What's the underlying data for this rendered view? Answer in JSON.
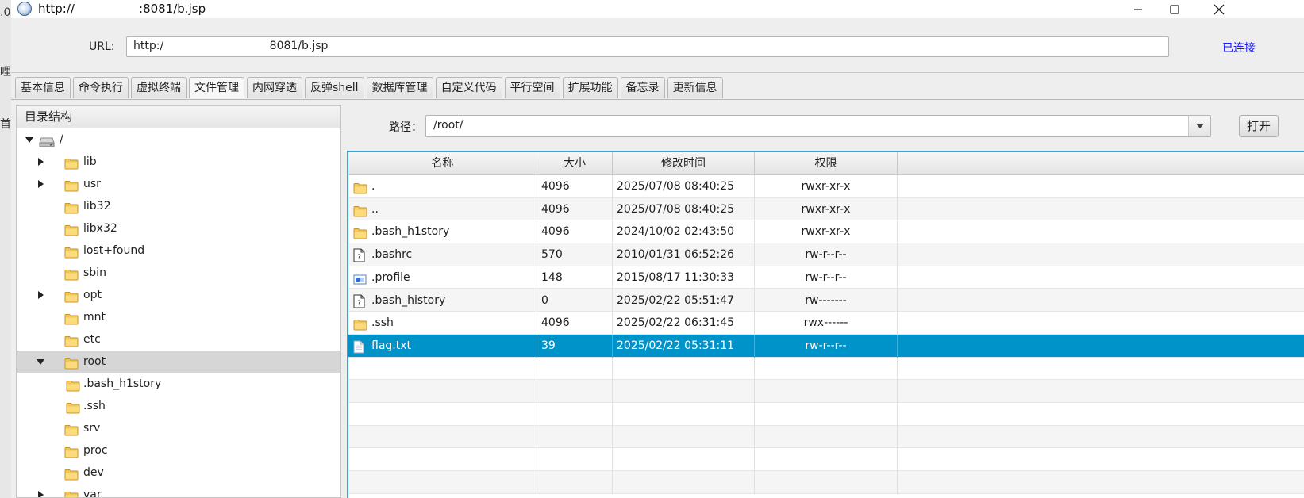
{
  "background": {
    "left_chars": [
      ".0",
      "哩",
      "首"
    ]
  },
  "window": {
    "title": "http://                 :8081/b.jsp",
    "controls": {
      "minimize": "minimize-icon",
      "maximize": "maximize-icon",
      "close": "close-icon"
    }
  },
  "url_bar": {
    "label": "URL:",
    "value": "http:/                              8081/b.jsp",
    "status": "已连接",
    "status_color": "#1a1aff"
  },
  "tabs": [
    {
      "label": "基本信息"
    },
    {
      "label": "命令执行"
    },
    {
      "label": "虚拟终端"
    },
    {
      "label": "文件管理",
      "active": true
    },
    {
      "label": "内网穿透"
    },
    {
      "label": "反弹shell"
    },
    {
      "label": "数据库管理"
    },
    {
      "label": "自定义代码"
    },
    {
      "label": "平行空间"
    },
    {
      "label": "扩展功能"
    },
    {
      "label": "备忘录"
    },
    {
      "label": "更新信息"
    }
  ],
  "tree": {
    "header": "目录结构",
    "items": [
      {
        "label": "/",
        "level": 0,
        "state": "expanded",
        "icon": "drive-icon"
      },
      {
        "label": "lib",
        "level": 1,
        "state": "collapsed",
        "icon": "folder-icon"
      },
      {
        "label": "usr",
        "level": 1,
        "state": "collapsed",
        "icon": "folder-icon"
      },
      {
        "label": "lib32",
        "level": 1,
        "state": "leaf",
        "icon": "folder-icon"
      },
      {
        "label": "libx32",
        "level": 1,
        "state": "leaf",
        "icon": "folder-icon"
      },
      {
        "label": "lost+found",
        "level": 1,
        "state": "leaf",
        "icon": "folder-icon"
      },
      {
        "label": "sbin",
        "level": 1,
        "state": "leaf",
        "icon": "folder-icon"
      },
      {
        "label": "opt",
        "level": 1,
        "state": "collapsed",
        "icon": "folder-icon"
      },
      {
        "label": "mnt",
        "level": 1,
        "state": "leaf",
        "icon": "folder-icon"
      },
      {
        "label": "etc",
        "level": 1,
        "state": "leaf",
        "icon": "folder-icon"
      },
      {
        "label": "root",
        "level": 1,
        "state": "expanded",
        "icon": "folder-icon",
        "selected": true
      },
      {
        "label": ".bash_h1story",
        "level": 2,
        "state": "leaf",
        "icon": "folder-icon"
      },
      {
        "label": ".ssh",
        "level": 2,
        "state": "leaf",
        "icon": "folder-icon"
      },
      {
        "label": "srv",
        "level": 1,
        "state": "leaf",
        "icon": "folder-icon"
      },
      {
        "label": "proc",
        "level": 1,
        "state": "leaf",
        "icon": "folder-icon"
      },
      {
        "label": "dev",
        "level": 1,
        "state": "leaf",
        "icon": "folder-icon"
      },
      {
        "label": "var",
        "level": 1,
        "state": "collapsed",
        "icon": "folder-icon"
      }
    ]
  },
  "path_bar": {
    "label": "路径：",
    "value": "/root/",
    "open_button": "打开"
  },
  "file_table": {
    "columns": [
      "名称",
      "大小",
      "修改时间",
      "权限"
    ],
    "rows": [
      {
        "icon": "folder-icon",
        "name": ".",
        "size": "4096",
        "mtime": "2025/07/08 08:40:25",
        "perm": "rwxr-xr-x"
      },
      {
        "icon": "folder-icon",
        "name": "..",
        "size": "4096",
        "mtime": "2025/07/08 08:40:25",
        "perm": "rwxr-xr-x"
      },
      {
        "icon": "folder-icon",
        "name": ".bash_h1story",
        "size": "4096",
        "mtime": "2024/10/02 02:43:50",
        "perm": "rwxr-xr-x"
      },
      {
        "icon": "unknown-file-icon",
        "name": ".bashrc",
        "size": "570",
        "mtime": "2010/01/31 06:52:26",
        "perm": "rw-r--r--"
      },
      {
        "icon": "profile-file-icon",
        "name": ".profile",
        "size": "148",
        "mtime": "2015/08/17 11:30:33",
        "perm": "rw-r--r--"
      },
      {
        "icon": "unknown-file-icon",
        "name": ".bash_history",
        "size": "0",
        "mtime": "2025/02/22 05:51:47",
        "perm": "rw-------"
      },
      {
        "icon": "folder-icon",
        "name": ".ssh",
        "size": "4096",
        "mtime": "2025/02/22 06:31:45",
        "perm": "rwx------"
      },
      {
        "icon": "text-file-icon",
        "name": "flag.txt",
        "size": "39",
        "mtime": "2025/02/22 05:31:11",
        "perm": "rw-r--r--",
        "selected": true
      }
    ],
    "selection_color": "#0093c9"
  }
}
